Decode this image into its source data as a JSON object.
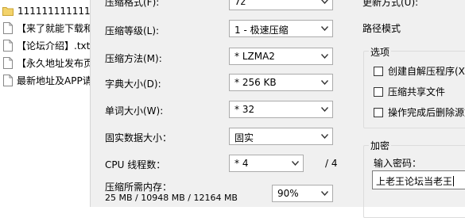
{
  "files": [
    {
      "name": "111111111111111111",
      "icon": "folder-icon"
    },
    {
      "name": "【来了就能下载和",
      "icon": "file-icon"
    },
    {
      "name": "【论坛介绍】.txt",
      "icon": "file-icon"
    },
    {
      "name": "【永久地址发布页",
      "icon": "file-icon"
    },
    {
      "name": "最新地址及APP请",
      "icon": "file-icon"
    }
  ],
  "dialog": {
    "format": {
      "label": "压缩格式(F):",
      "value": "7z"
    },
    "level": {
      "label": "压缩等级(L):",
      "value": "1 - 极速压缩"
    },
    "method": {
      "label": "压缩方法(M):",
      "value": "* LZMA2"
    },
    "dict": {
      "label": "字典大小(D):",
      "value": "* 256 KB"
    },
    "word": {
      "label": "单词大小(W):",
      "value": "* 32"
    },
    "solid": {
      "label": "固实数据大小：",
      "value": "固实"
    },
    "threads": {
      "label": "CPU 线程数：",
      "value": "* 4",
      "max": "/ 4"
    },
    "memory": {
      "label": "压缩所需内存：",
      "detail": "25 MB / 10948 MB / 12164 MB",
      "percent": "90%"
    },
    "update": {
      "label": "更新方式(U):"
    },
    "path_mode": {
      "label": "路径模式"
    },
    "options": {
      "title": "选项",
      "items": [
        {
          "label": "创建自解压程序(X)"
        },
        {
          "label": "压缩共享文件"
        },
        {
          "label": "操作完成后删除源文"
        }
      ]
    },
    "encryption": {
      "title": "加密",
      "password_label": "输入密码：",
      "password_value": "上老王论坛当老王"
    }
  }
}
